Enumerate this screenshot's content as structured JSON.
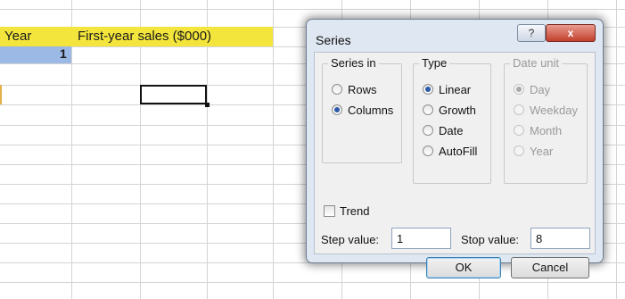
{
  "spreadsheet": {
    "header_year": "Year",
    "header_sales": "First-year sales ($000)",
    "cell_year_value": "1"
  },
  "dialog": {
    "title": "Series",
    "help_glyph": "?",
    "close_glyph": "x",
    "series_in": {
      "label": "Series in",
      "options": [
        {
          "label": "Rows",
          "checked": false
        },
        {
          "label": "Columns",
          "checked": true
        }
      ]
    },
    "type": {
      "label": "Type",
      "options": [
        {
          "label": "Linear",
          "checked": true
        },
        {
          "label": "Growth",
          "checked": false
        },
        {
          "label": "Date",
          "checked": false
        },
        {
          "label": "AutoFill",
          "checked": false
        }
      ]
    },
    "date_unit": {
      "label": "Date unit",
      "options": [
        {
          "label": "Day",
          "checked": true
        },
        {
          "label": "Weekday",
          "checked": false
        },
        {
          "label": "Month",
          "checked": false
        },
        {
          "label": "Year",
          "checked": false
        }
      ]
    },
    "trend_label": "Trend",
    "step_value_label": "Step value:",
    "step_value": "1",
    "stop_value_label": "Stop value:",
    "stop_value": "8",
    "ok_label": "OK",
    "cancel_label": "Cancel"
  },
  "colors": {
    "header_band": "#f3e53c",
    "selected_cell": "#9cb8e4",
    "dialog_frame": "#dfe7f2",
    "close_button": "#c1412d"
  }
}
